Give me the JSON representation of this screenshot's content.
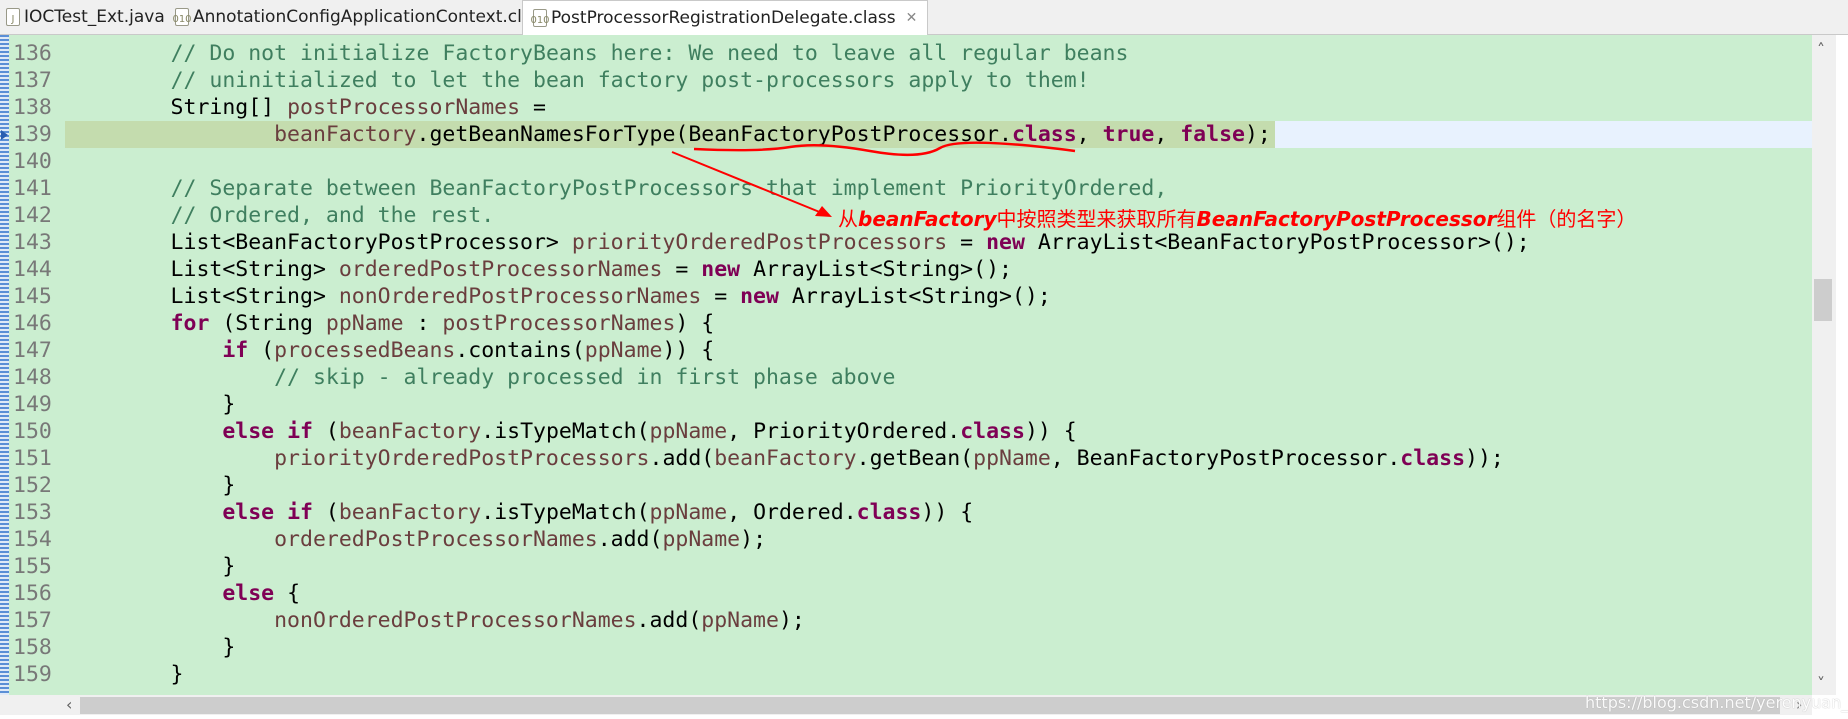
{
  "tabs": [
    {
      "label": "IOCTest_Ext.java",
      "icon": "java-file-icon",
      "active": false
    },
    {
      "label": "AnnotationConfigApplicationContext.class",
      "icon": "class-file-icon",
      "active": false
    },
    {
      "label": "PostProcessorRegistrationDelegate.class",
      "icon": "class-file-icon",
      "active": true
    }
  ],
  "close_symbol": "✕",
  "current_line": 139,
  "lines": [
    {
      "n": "136",
      "text": "        // Do not initialize FactoryBeans here: We need to leave all regular beans"
    },
    {
      "n": "137",
      "text": "        // uninitialized to let the bean factory post-processors apply to them!"
    },
    {
      "n": "138",
      "text": "        String[] postProcessorNames ="
    },
    {
      "n": "139",
      "text": "                beanFactory.getBeanNamesForType(BeanFactoryPostProcessor.class, true, false);"
    },
    {
      "n": "140",
      "text": ""
    },
    {
      "n": "141",
      "text": "        // Separate between BeanFactoryPostProcessors that implement PriorityOrdered,"
    },
    {
      "n": "142",
      "text": "        // Ordered, and the rest."
    },
    {
      "n": "143",
      "text": "        List<BeanFactoryPostProcessor> priorityOrderedPostProcessors = new ArrayList<BeanFactoryPostProcessor>();"
    },
    {
      "n": "144",
      "text": "        List<String> orderedPostProcessorNames = new ArrayList<String>();"
    },
    {
      "n": "145",
      "text": "        List<String> nonOrderedPostProcessorNames = new ArrayList<String>();"
    },
    {
      "n": "146",
      "text": "        for (String ppName : postProcessorNames) {"
    },
    {
      "n": "147",
      "text": "            if (processedBeans.contains(ppName)) {"
    },
    {
      "n": "148",
      "text": "                // skip - already processed in first phase above"
    },
    {
      "n": "149",
      "text": "            }"
    },
    {
      "n": "150",
      "text": "            else if (beanFactory.isTypeMatch(ppName, PriorityOrdered.class)) {"
    },
    {
      "n": "151",
      "text": "                priorityOrderedPostProcessors.add(beanFactory.getBean(ppName, BeanFactoryPostProcessor.class));"
    },
    {
      "n": "152",
      "text": "            }"
    },
    {
      "n": "153",
      "text": "            else if (beanFactory.isTypeMatch(ppName, Ordered.class)) {"
    },
    {
      "n": "154",
      "text": "                orderedPostProcessorNames.add(ppName);"
    },
    {
      "n": "155",
      "text": "            }"
    },
    {
      "n": "156",
      "text": "            else {"
    },
    {
      "n": "157",
      "text": "                nonOrderedPostProcessorNames.add(ppName);"
    },
    {
      "n": "158",
      "text": "            }"
    },
    {
      "n": "159",
      "text": "        }"
    }
  ],
  "annotation": {
    "text_parts": [
      "从",
      "beanFactory",
      "中按照类型来获取所有",
      "BeanFactoryPostProcessor",
      "组件（的名字）"
    ],
    "color": "#ff0000"
  },
  "watermark": "https://blog.csdn.net/yerenyuan_pku",
  "colors": {
    "background": "#cbeed0",
    "keyword": "#7f0055",
    "comment": "#3f7f5f",
    "variable": "#6a3e3e",
    "current_line": "#c4dcae"
  }
}
